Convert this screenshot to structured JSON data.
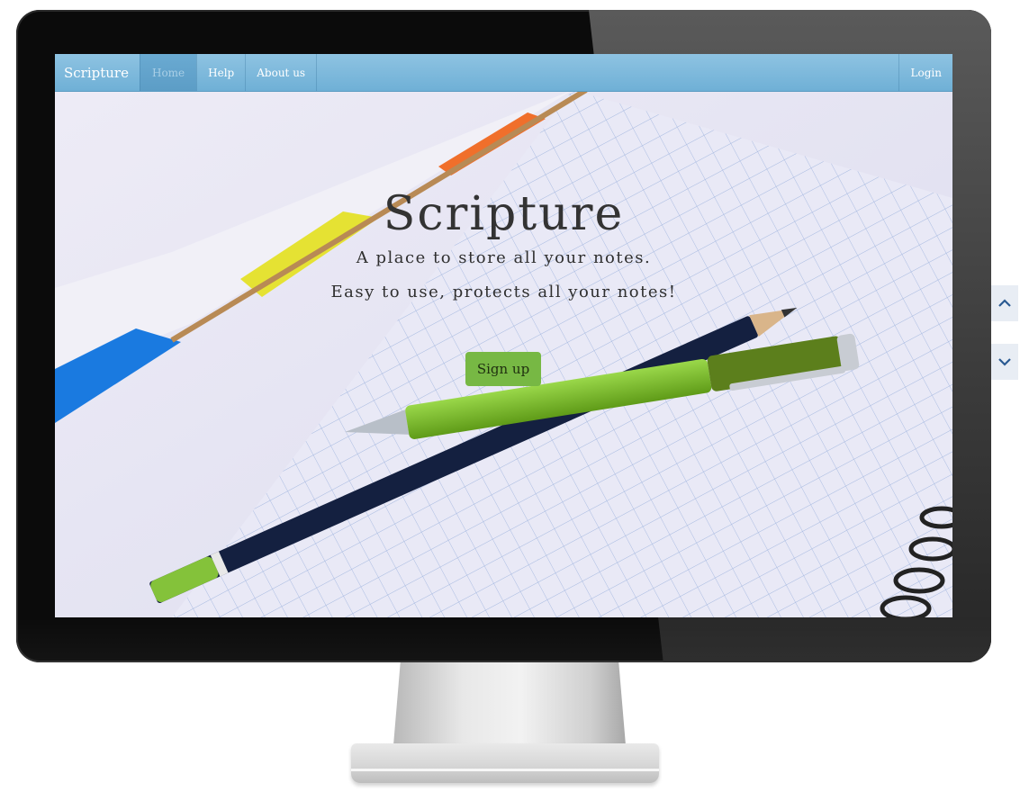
{
  "navbar": {
    "brand": "Scripture",
    "items": [
      {
        "label": "Home",
        "active": true
      },
      {
        "label": "Help",
        "active": false
      },
      {
        "label": "About us",
        "active": false
      }
    ],
    "login_label": "Login"
  },
  "hero": {
    "title": "Scripture",
    "subtitle": "A place to store all your notes.",
    "subtitle2": "Easy to use, protects all your notes!",
    "signup_label": "Sign up"
  },
  "scroll": {
    "up_icon": "chevron-up-icon",
    "down_icon": "chevron-down-icon"
  },
  "colors": {
    "navbar": "#7bb8dc",
    "signup_button": "#77b844",
    "monitor_frame": "#0b0b0b"
  }
}
